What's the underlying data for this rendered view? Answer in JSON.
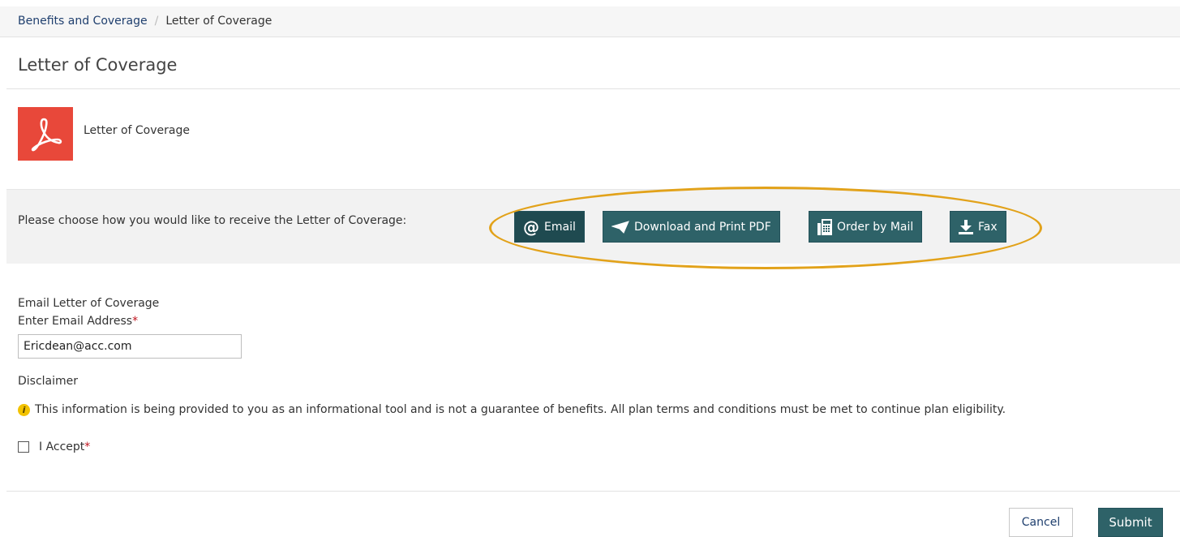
{
  "breadcrumb": {
    "parent": "Benefits and Coverage",
    "separator": "/",
    "current": "Letter of Coverage"
  },
  "page_title": "Letter of Coverage",
  "document": {
    "icon": "pdf-icon",
    "label": "Letter of Coverage"
  },
  "delivery": {
    "prompt": "Please choose how you would like to receive the Letter of Coverage:",
    "options": [
      {
        "label": "Email",
        "icon": "at-icon",
        "selected": true
      },
      {
        "label": "Download and Print PDF",
        "icon": "paper-plane-icon",
        "selected": false
      },
      {
        "label": "Order by Mail",
        "icon": "fax-machine-icon",
        "selected": false
      },
      {
        "label": "Fax",
        "icon": "download-icon",
        "selected": false
      }
    ]
  },
  "form": {
    "heading": "Email Letter of Coverage",
    "email_label": "Enter Email Address",
    "required_mark": "*",
    "email_value": "Ericdean@acc.com",
    "disclaimer_label": "Disclaimer",
    "disclaimer_text": "This information is being provided to you as an informational tool and is not a guarantee of benefits. All plan terms and conditions must be met to continue plan eligibility.",
    "info_icon_glyph": "i",
    "accept_label": "I Accept",
    "accept_checked": false
  },
  "actions": {
    "cancel_label": "Cancel",
    "submit_label": "Submit"
  },
  "colors": {
    "button_teal": "#2e6268",
    "pdf_red": "#e8483a",
    "highlight": "#e2a21a",
    "required": "#c0141e",
    "link": "#1f3f6e"
  }
}
